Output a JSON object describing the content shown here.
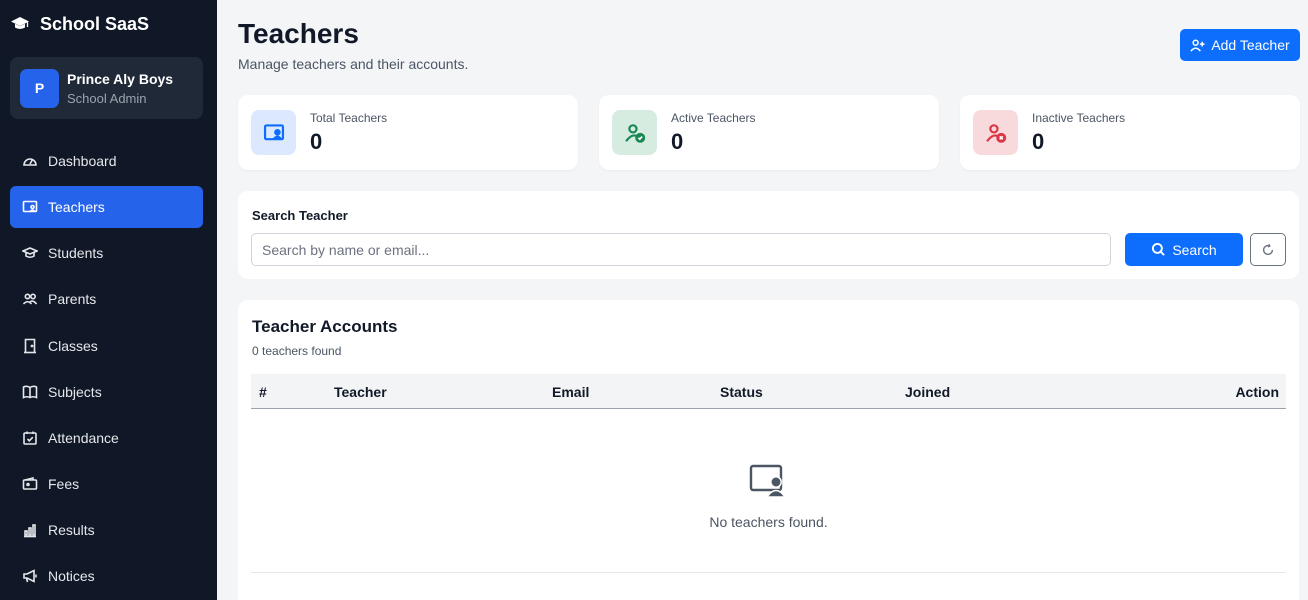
{
  "app": {
    "name": "School SaaS",
    "icon": "graduation-cap-icon"
  },
  "profile": {
    "initial": "P",
    "name": "Prince Aly Boys",
    "role": "School Admin"
  },
  "nav": [
    {
      "label": "Dashboard",
      "icon": "gauge-icon",
      "active": false
    },
    {
      "label": "Teachers",
      "icon": "teacher-board-icon",
      "active": true
    },
    {
      "label": "Students",
      "icon": "mortarboard-icon",
      "active": false
    },
    {
      "label": "Parents",
      "icon": "people-icon",
      "active": false
    },
    {
      "label": "Classes",
      "icon": "door-icon",
      "active": false
    },
    {
      "label": "Subjects",
      "icon": "book-icon",
      "active": false
    },
    {
      "label": "Attendance",
      "icon": "calendar-check-icon",
      "active": false
    },
    {
      "label": "Fees",
      "icon": "wallet-icon",
      "active": false
    },
    {
      "label": "Results",
      "icon": "bar-chart-icon",
      "active": false
    },
    {
      "label": "Notices",
      "icon": "megaphone-icon",
      "active": false
    }
  ],
  "header": {
    "title": "Teachers",
    "subtitle": "Manage teachers and their accounts.",
    "add_button": "Add Teacher"
  },
  "stats": [
    {
      "label": "Total Teachers",
      "value": "0",
      "icon": "teacher-board-icon",
      "color": "#0d6efd",
      "bg": "#dbe8fd"
    },
    {
      "label": "Active Teachers",
      "value": "0",
      "icon": "user-check-icon",
      "color": "#198754",
      "bg": "#d7ece1"
    },
    {
      "label": "Inactive Teachers",
      "value": "0",
      "icon": "user-x-icon",
      "color": "#dc3545",
      "bg": "#f8dadd"
    }
  ],
  "search": {
    "title": "Search Teacher",
    "placeholder": "Search by name or email...",
    "value": "",
    "button": "Search"
  },
  "table": {
    "title": "Teacher Accounts",
    "count": "0 teachers found",
    "columns": [
      "#",
      "Teacher",
      "Email",
      "Status",
      "Joined",
      "Action"
    ],
    "rows": [],
    "empty_text": "No teachers found."
  },
  "colors": {
    "sidebar": "#101827",
    "accent": "#0d6efd",
    "nav_active": "#2563eb"
  }
}
